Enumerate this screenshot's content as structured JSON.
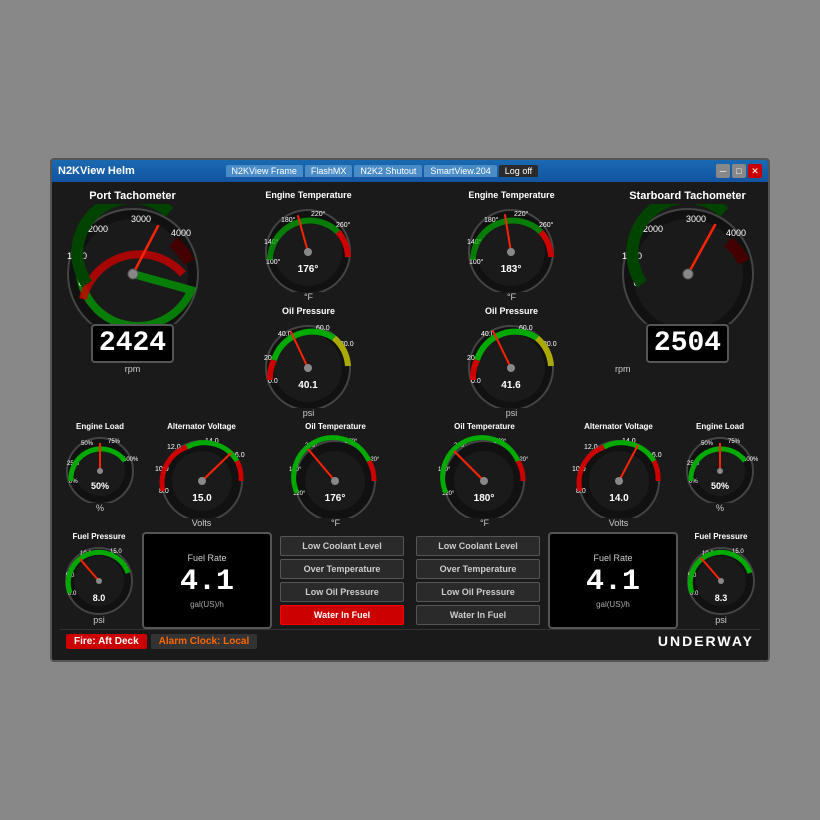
{
  "window": {
    "title": "N2KView Helm",
    "tabs": [
      "N2KView Frame",
      "FlashMX",
      "N2K2 Shutout",
      "SmartView.204",
      "Log off"
    ],
    "active_tab": 4
  },
  "port_tach": {
    "label": "Port Tachometer",
    "value": "2424",
    "unit": "rpm",
    "max": 4000,
    "current": 2424
  },
  "starboard_tach": {
    "label": "Starboard Tachometer",
    "value": "2504",
    "unit": "rpm",
    "max": 4000,
    "current": 2504
  },
  "engine_temp_port": {
    "label": "Engine Temperature",
    "value": "176°",
    "unit": "°F"
  },
  "engine_temp_stbd": {
    "label": "Engine Temperature",
    "value": "183°",
    "unit": "°F"
  },
  "oil_pressure_port": {
    "label": "Oil Pressure",
    "value": "40.1",
    "unit": "psi"
  },
  "oil_pressure_stbd": {
    "label": "Oil Pressure",
    "value": "41.6",
    "unit": "psi"
  },
  "engine_load_port": {
    "label": "Engine Load",
    "value": "50%",
    "unit": "%"
  },
  "engine_load_stbd": {
    "label": "Engine Load",
    "value": "50%",
    "unit": "%"
  },
  "alt_voltage_port": {
    "label": "Alternator Voltage",
    "value": "15.0",
    "unit": "Volts"
  },
  "alt_voltage_stbd": {
    "label": "Alternator Voltage",
    "value": "14.0",
    "unit": "Volts"
  },
  "oil_temp_port": {
    "label": "Oil Temperature",
    "value": "176°",
    "unit": "°F"
  },
  "oil_temp_stbd": {
    "label": "Oil Temperature",
    "value": "180°",
    "unit": "°F"
  },
  "fuel_pressure_port": {
    "label": "Fuel Pressure",
    "value": "8.0",
    "unit": "psi"
  },
  "fuel_pressure_stbd": {
    "label": "Fuel Pressure",
    "value": "8.3",
    "unit": "psi"
  },
  "fuel_rate_port": {
    "label": "Fuel Rate",
    "value": "4.1",
    "unit": "gal(US)/h"
  },
  "fuel_rate_stbd": {
    "label": "Fuel Rate",
    "value": "4.1",
    "unit": "gal(US)/h"
  },
  "alarms_port": [
    {
      "label": "Low Coolant Level",
      "active": false
    },
    {
      "label": "Over Temperature",
      "active": false
    },
    {
      "label": "Low Oil Pressure",
      "active": false
    },
    {
      "label": "Water In Fuel",
      "active": true
    }
  ],
  "alarms_stbd": [
    {
      "label": "Low Coolant Level",
      "active": false
    },
    {
      "label": "Over Temperature",
      "active": false
    },
    {
      "label": "Low Oil Pressure",
      "active": false
    },
    {
      "label": "Water In Fuel",
      "active": false
    }
  ],
  "bottom": {
    "fire_label": "Fire: Aft Deck",
    "alarm_label": "Alarm Clock: Local",
    "status_label": "UNDERWAY"
  }
}
